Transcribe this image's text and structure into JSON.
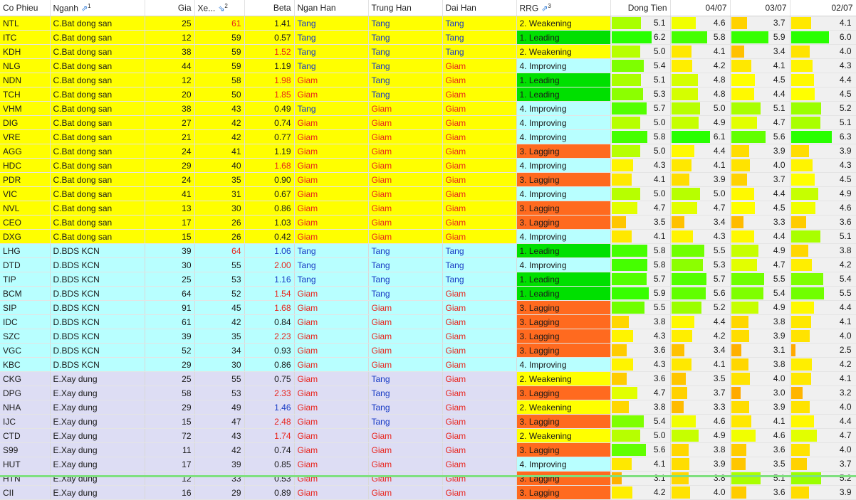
{
  "headers": {
    "code": "Co Phieu",
    "sector": "Nganh",
    "sector_sort": "1",
    "price": "Gia",
    "rank": "Xe...",
    "rank_sort": "2",
    "beta": "Beta",
    "short": "Ngan Han",
    "mid": "Trung Han",
    "long": "Dai Han",
    "rrg": "RRG",
    "rrg_sort": "3",
    "flow": "Dong Tien",
    "d1": "04/07",
    "d2": "03/07",
    "d3": "02/07"
  },
  "colors": {
    "group_C": "#ffff00",
    "group_D": "#b8ffff",
    "group_E": "#ddddf4",
    "rrg_leading": "#00e000",
    "rrg_improving": "#b8ffff",
    "rrg_weakening": "#ffff00",
    "rrg_lagging": "#ff6a1f"
  },
  "rows": [
    {
      "code": "NTL",
      "sector": "C.Bat dong san",
      "price": "25",
      "rank": "61",
      "rank_red": true,
      "beta": "1.41",
      "beta_c": "",
      "short": "Tang",
      "mid": "Tang",
      "long": "Tang",
      "rrg": "2. Weakening",
      "flow": "5.1",
      "d1": "4.6",
      "d2": "3.7",
      "d3": "4.1"
    },
    {
      "code": "ITC",
      "sector": "C.Bat dong san",
      "price": "12",
      "rank": "59",
      "beta": "0.57",
      "beta_c": "",
      "short": "Tang",
      "mid": "Tang",
      "long": "Tang",
      "rrg": "1. Leading",
      "flow": "6.2",
      "d1": "5.8",
      "d2": "5.9",
      "d3": "6.0"
    },
    {
      "code": "KDH",
      "sector": "C.Bat dong san",
      "price": "38",
      "rank": "59",
      "beta": "1.52",
      "beta_c": "red",
      "short": "Tang",
      "mid": "Tang",
      "long": "Tang",
      "rrg": "2. Weakening",
      "flow": "5.0",
      "d1": "4.1",
      "d2": "3.4",
      "d3": "4.0"
    },
    {
      "code": "NLG",
      "sector": "C.Bat dong san",
      "price": "44",
      "rank": "59",
      "beta": "1.19",
      "beta_c": "",
      "short": "Tang",
      "mid": "Tang",
      "long": "Giam",
      "rrg": "4. Improving",
      "flow": "5.4",
      "d1": "4.2",
      "d2": "4.1",
      "d3": "4.3"
    },
    {
      "code": "NDN",
      "sector": "C.Bat dong san",
      "price": "12",
      "rank": "58",
      "beta": "1.98",
      "beta_c": "red",
      "short": "Giam",
      "mid": "Tang",
      "long": "Giam",
      "rrg": "1. Leading",
      "flow": "5.1",
      "d1": "4.8",
      "d2": "4.5",
      "d3": "4.4"
    },
    {
      "code": "TCH",
      "sector": "C.Bat dong san",
      "price": "20",
      "rank": "50",
      "beta": "1.85",
      "beta_c": "red",
      "short": "Giam",
      "mid": "Tang",
      "long": "Giam",
      "rrg": "1. Leading",
      "flow": "5.3",
      "d1": "4.8",
      "d2": "4.4",
      "d3": "4.5"
    },
    {
      "code": "VHM",
      "sector": "C.Bat dong san",
      "price": "38",
      "rank": "43",
      "beta": "0.49",
      "beta_c": "",
      "short": "Tang",
      "mid": "Giam",
      "long": "Giam",
      "rrg": "4. Improving",
      "flow": "5.7",
      "d1": "5.0",
      "d2": "5.1",
      "d3": "5.2"
    },
    {
      "code": "DIG",
      "sector": "C.Bat dong san",
      "price": "27",
      "rank": "42",
      "beta": "0.74",
      "beta_c": "",
      "short": "Giam",
      "mid": "Giam",
      "long": "Giam",
      "rrg": "4. Improving",
      "flow": "5.0",
      "d1": "4.9",
      "d2": "4.7",
      "d3": "5.1"
    },
    {
      "code": "VRE",
      "sector": "C.Bat dong san",
      "price": "21",
      "rank": "42",
      "beta": "0.77",
      "beta_c": "",
      "short": "Giam",
      "mid": "Giam",
      "long": "Giam",
      "rrg": "4. Improving",
      "flow": "5.8",
      "d1": "6.1",
      "d2": "5.6",
      "d3": "6.3"
    },
    {
      "code": "AGG",
      "sector": "C.Bat dong san",
      "price": "24",
      "rank": "41",
      "beta": "1.19",
      "beta_c": "",
      "short": "Giam",
      "mid": "Giam",
      "long": "Giam",
      "rrg": "3. Lagging",
      "flow": "5.0",
      "d1": "4.4",
      "d2": "3.9",
      "d3": "3.9"
    },
    {
      "code": "HDC",
      "sector": "C.Bat dong san",
      "price": "29",
      "rank": "40",
      "beta": "1.68",
      "beta_c": "red",
      "short": "Giam",
      "mid": "Giam",
      "long": "Giam",
      "rrg": "4. Improving",
      "flow": "4.3",
      "d1": "4.1",
      "d2": "4.0",
      "d3": "4.3"
    },
    {
      "code": "PDR",
      "sector": "C.Bat dong san",
      "price": "24",
      "rank": "35",
      "beta": "0.90",
      "beta_c": "",
      "short": "Giam",
      "mid": "Giam",
      "long": "Giam",
      "rrg": "3. Lagging",
      "flow": "4.1",
      "d1": "3.9",
      "d2": "3.7",
      "d3": "4.5"
    },
    {
      "code": "VIC",
      "sector": "C.Bat dong san",
      "price": "41",
      "rank": "31",
      "beta": "0.67",
      "beta_c": "",
      "short": "Giam",
      "mid": "Giam",
      "long": "Giam",
      "rrg": "4. Improving",
      "flow": "5.0",
      "d1": "5.0",
      "d2": "4.4",
      "d3": "4.9"
    },
    {
      "code": "NVL",
      "sector": "C.Bat dong san",
      "price": "13",
      "rank": "30",
      "beta": "0.86",
      "beta_c": "",
      "short": "Giam",
      "mid": "Giam",
      "long": "Giam",
      "rrg": "3. Lagging",
      "flow": "4.7",
      "d1": "4.7",
      "d2": "4.5",
      "d3": "4.6"
    },
    {
      "code": "CEO",
      "sector": "C.Bat dong san",
      "price": "17",
      "rank": "26",
      "beta": "1.03",
      "beta_c": "",
      "short": "Giam",
      "mid": "Giam",
      "long": "Giam",
      "rrg": "3. Lagging",
      "flow": "3.5",
      "d1": "3.4",
      "d2": "3.3",
      "d3": "3.6"
    },
    {
      "code": "DXG",
      "sector": "C.Bat dong san",
      "price": "15",
      "rank": "26",
      "beta": "0.42",
      "beta_c": "",
      "short": "Giam",
      "mid": "Giam",
      "long": "Giam",
      "rrg": "4. Improving",
      "flow": "4.1",
      "d1": "4.3",
      "d2": "4.4",
      "d3": "5.1"
    },
    {
      "code": "LHG",
      "sector": "D.BDS KCN",
      "price": "39",
      "rank": "64",
      "rank_red": true,
      "beta": "1.06",
      "beta_c": "blue",
      "short": "Tang",
      "mid": "Tang",
      "long": "Tang",
      "rrg": "1. Leading",
      "flow": "5.8",
      "d1": "5.5",
      "d2": "4.9",
      "d3": "3.8"
    },
    {
      "code": "DTD",
      "sector": "D.BDS KCN",
      "price": "30",
      "rank": "55",
      "beta": "2.00",
      "beta_c": "red",
      "short": "Tang",
      "mid": "Tang",
      "long": "Tang",
      "rrg": "4. Improving",
      "flow": "5.8",
      "d1": "5.3",
      "d2": "4.7",
      "d3": "4.2"
    },
    {
      "code": "TIP",
      "sector": "D.BDS KCN",
      "price": "25",
      "rank": "53",
      "beta": "1.16",
      "beta_c": "blue",
      "short": "Tang",
      "mid": "Tang",
      "long": "Tang",
      "rrg": "1. Leading",
      "flow": "5.7",
      "d1": "5.7",
      "d2": "5.5",
      "d3": "5.4"
    },
    {
      "code": "BCM",
      "sector": "D.BDS KCN",
      "price": "64",
      "rank": "52",
      "beta": "1.54",
      "beta_c": "red",
      "short": "Giam",
      "mid": "Tang",
      "long": "Giam",
      "rrg": "1. Leading",
      "flow": "5.9",
      "d1": "5.6",
      "d2": "5.4",
      "d3": "5.5"
    },
    {
      "code": "SIP",
      "sector": "D.BDS KCN",
      "price": "91",
      "rank": "45",
      "beta": "1.68",
      "beta_c": "red",
      "short": "Giam",
      "mid": "Giam",
      "long": "Giam",
      "rrg": "3. Lagging",
      "flow": "5.5",
      "d1": "5.2",
      "d2": "4.9",
      "d3": "4.4"
    },
    {
      "code": "IDC",
      "sector": "D.BDS KCN",
      "price": "61",
      "rank": "42",
      "beta": "0.84",
      "beta_c": "",
      "short": "Giam",
      "mid": "Giam",
      "long": "Giam",
      "rrg": "3. Lagging",
      "flow": "3.8",
      "d1": "4.4",
      "d2": "3.8",
      "d3": "4.1"
    },
    {
      "code": "SZC",
      "sector": "D.BDS KCN",
      "price": "39",
      "rank": "35",
      "beta": "2.23",
      "beta_c": "red",
      "short": "Giam",
      "mid": "Giam",
      "long": "Giam",
      "rrg": "3. Lagging",
      "flow": "4.3",
      "d1": "4.2",
      "d2": "3.9",
      "d3": "4.0"
    },
    {
      "code": "VGC",
      "sector": "D.BDS KCN",
      "price": "52",
      "rank": "34",
      "beta": "0.93",
      "beta_c": "",
      "short": "Giam",
      "mid": "Giam",
      "long": "Giam",
      "rrg": "3. Lagging",
      "flow": "3.6",
      "d1": "3.4",
      "d2": "3.1",
      "d3": "2.5"
    },
    {
      "code": "KBC",
      "sector": "D.BDS KCN",
      "price": "29",
      "rank": "30",
      "beta": "0.86",
      "beta_c": "",
      "short": "Giam",
      "mid": "Giam",
      "long": "Giam",
      "rrg": "4. Improving",
      "flow": "4.3",
      "d1": "4.1",
      "d2": "3.8",
      "d3": "4.2"
    },
    {
      "code": "CKG",
      "sector": "E.Xay dung",
      "price": "25",
      "rank": "55",
      "beta": "0.75",
      "beta_c": "",
      "short": "Giam",
      "mid": "Tang",
      "long": "Giam",
      "rrg": "2. Weakening",
      "flow": "3.6",
      "d1": "3.5",
      "d2": "4.0",
      "d3": "4.1"
    },
    {
      "code": "DPG",
      "sector": "E.Xay dung",
      "price": "58",
      "rank": "53",
      "beta": "2.33",
      "beta_c": "red",
      "short": "Giam",
      "mid": "Tang",
      "long": "Giam",
      "rrg": "3. Lagging",
      "flow": "4.7",
      "d1": "3.7",
      "d2": "3.0",
      "d3": "3.2"
    },
    {
      "code": "NHA",
      "sector": "E.Xay dung",
      "price": "29",
      "rank": "49",
      "beta": "1.46",
      "beta_c": "blue",
      "short": "Giam",
      "mid": "Tang",
      "long": "Giam",
      "rrg": "2. Weakening",
      "flow": "3.8",
      "d1": "3.3",
      "d2": "3.9",
      "d3": "4.0"
    },
    {
      "code": "IJC",
      "sector": "E.Xay dung",
      "price": "15",
      "rank": "47",
      "beta": "2.48",
      "beta_c": "red",
      "short": "Giam",
      "mid": "Tang",
      "long": "Giam",
      "rrg": "3. Lagging",
      "flow": "5.4",
      "d1": "4.6",
      "d2": "4.1",
      "d3": "4.4"
    },
    {
      "code": "CTD",
      "sector": "E.Xay dung",
      "price": "72",
      "rank": "43",
      "beta": "1.74",
      "beta_c": "red",
      "short": "Giam",
      "mid": "Giam",
      "long": "Giam",
      "rrg": "2. Weakening",
      "flow": "5.0",
      "d1": "4.9",
      "d2": "4.6",
      "d3": "4.7"
    },
    {
      "code": "S99",
      "sector": "E.Xay dung",
      "price": "11",
      "rank": "42",
      "beta": "0.74",
      "beta_c": "",
      "short": "Giam",
      "mid": "Giam",
      "long": "Giam",
      "rrg": "3. Lagging",
      "flow": "5.6",
      "d1": "3.8",
      "d2": "3.6",
      "d3": "4.0"
    },
    {
      "code": "HUT",
      "sector": "E.Xay dung",
      "price": "17",
      "rank": "39",
      "beta": "0.85",
      "beta_c": "",
      "short": "Giam",
      "mid": "Giam",
      "long": "Giam",
      "rrg": "4. Improving",
      "flow": "4.1",
      "d1": "3.9",
      "d2": "3.5",
      "d3": "3.7"
    },
    {
      "code": "HTN",
      "sector": "E.Xay dung",
      "price": "12",
      "rank": "33",
      "beta": "0.53",
      "beta_c": "",
      "short": "Giam",
      "mid": "Giam",
      "long": "Giam",
      "rrg": "3. Lagging",
      "flow": "3.1",
      "d1": "3.8",
      "d2": "5.1",
      "d3": "5.2"
    },
    {
      "code": "CII",
      "sector": "E.Xay dung",
      "price": "16",
      "rank": "29",
      "beta": "0.89",
      "beta_c": "",
      "short": "Giam",
      "mid": "Giam",
      "long": "Giam",
      "rrg": "3. Lagging",
      "flow": "4.2",
      "d1": "4.0",
      "d2": "3.6",
      "d3": "3.9"
    }
  ]
}
